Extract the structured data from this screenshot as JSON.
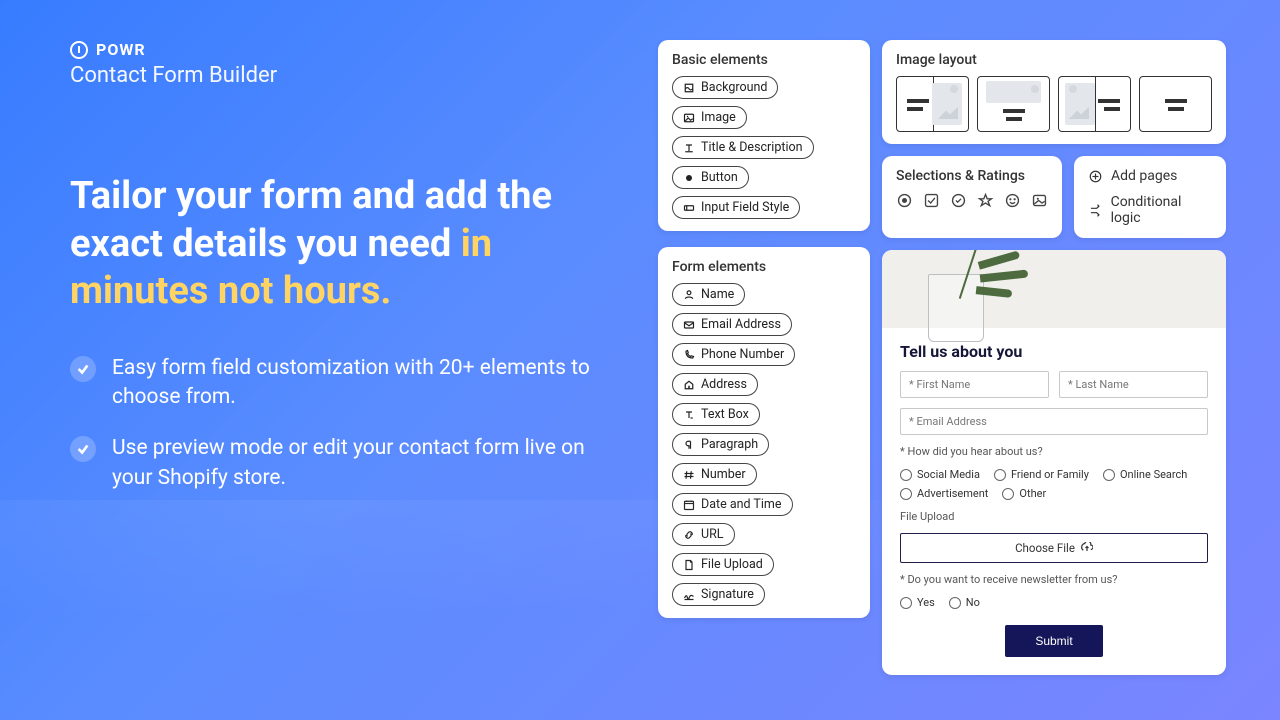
{
  "brand": {
    "name": "POWR",
    "product": "Contact Form Builder"
  },
  "headline": {
    "main": "Tailor your form and add the exact details you need ",
    "accent": "in minutes not hours."
  },
  "bullets": [
    "Easy form field customization with 20+ elements to choose from.",
    "Use preview mode or edit your contact form live on your Shopify store."
  ],
  "basic_elements": {
    "title": "Basic elements",
    "items": [
      "Background",
      "Image",
      "Title & Description",
      "Button",
      "Input Field Style"
    ]
  },
  "form_elements": {
    "title": "Form elements",
    "items": [
      "Name",
      "Email Address",
      "Phone Number",
      "Address",
      "Text Box",
      "Paragraph",
      "Number",
      "Date and Time",
      "URL",
      "File Upload",
      "Signature"
    ]
  },
  "image_layout": {
    "title": "Image layout"
  },
  "selections": {
    "title": "Selections & Ratings"
  },
  "options": {
    "add_pages": "Add pages",
    "conditional": "Conditional logic"
  },
  "form": {
    "title": "Tell us about you",
    "first_name": "* First Name",
    "last_name": "* Last Name",
    "email": "* Email Address",
    "q1": "* How did you hear about us?",
    "q1_options": [
      "Social Media",
      "Friend or Family",
      "Online Search",
      "Advertisement",
      "Other"
    ],
    "file_label": "File Upload",
    "choose_file": "Choose File",
    "q2": "* Do you want to receive newsletter from us?",
    "q2_options": [
      "Yes",
      "No"
    ],
    "submit": "Submit"
  }
}
